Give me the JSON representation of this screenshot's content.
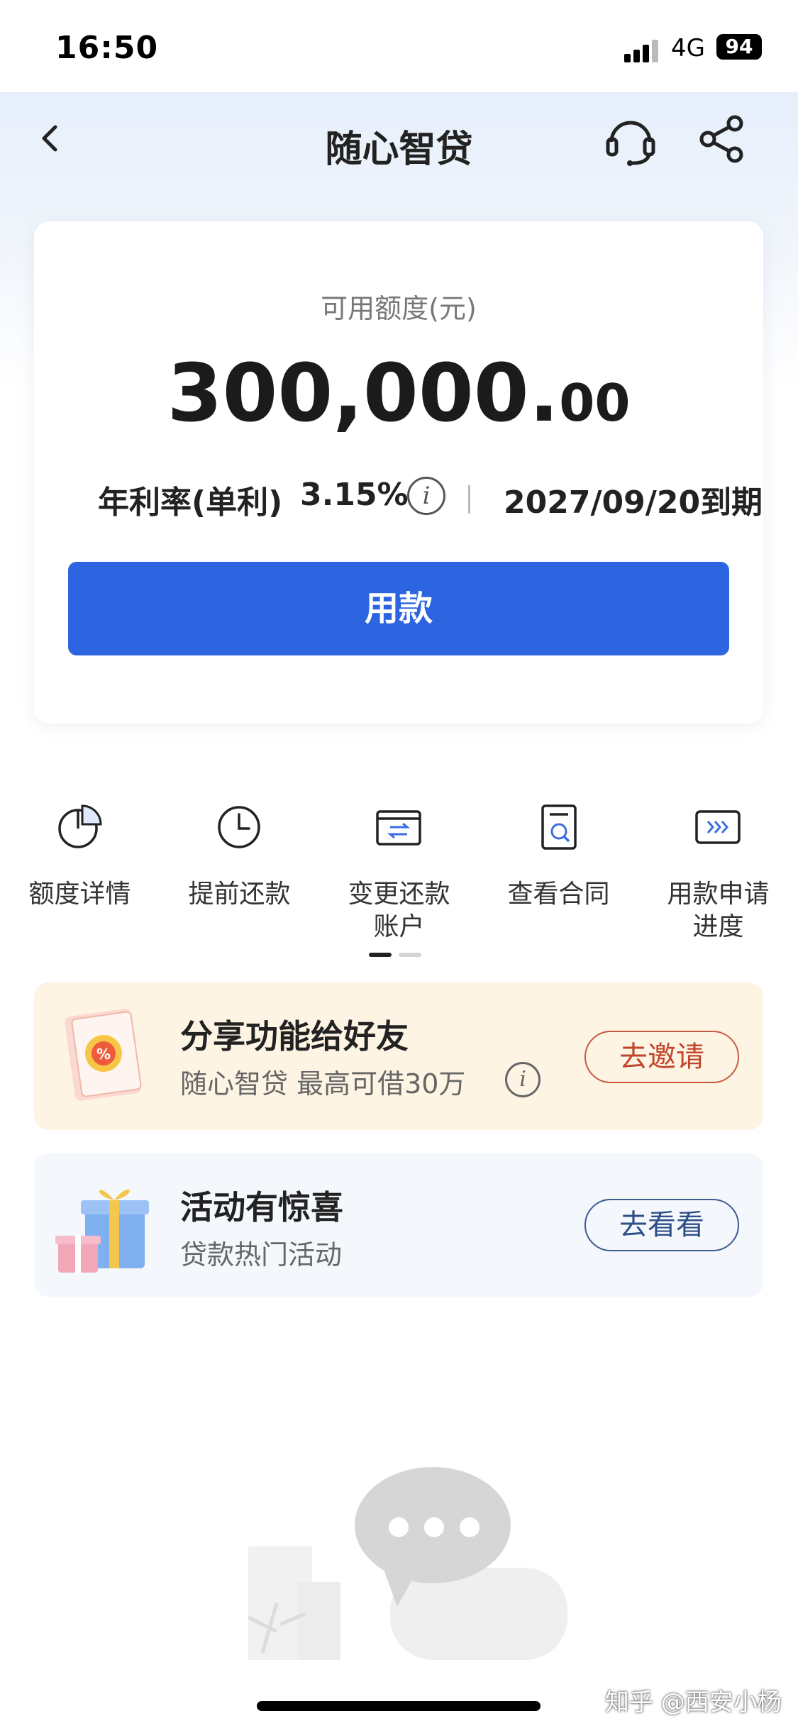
{
  "status_bar": {
    "time": "16:50",
    "network": "4G",
    "battery": "94"
  },
  "nav": {
    "title": "随心智贷",
    "back_icon": "chevron-left-icon",
    "service_icon": "headset-icon",
    "share_icon": "share-icon"
  },
  "credit": {
    "label": "可用额度(元)",
    "amount_int": "300,000.",
    "amount_dec": "00",
    "rate_label": "年利率(单利)",
    "rate_value": "3.15%",
    "info_glyph": "i",
    "due_date": "2027/09/20到期",
    "use_button": "用款"
  },
  "quick_actions": [
    {
      "label": "额度详情",
      "icon": "pie-chart-icon"
    },
    {
      "label": "提前还款",
      "icon": "clock-icon"
    },
    {
      "label_line1": "变更还款",
      "label_line2": "账户",
      "icon": "card-exchange-icon"
    },
    {
      "label": "查看合同",
      "icon": "contract-search-icon"
    },
    {
      "label_line1": "用款申请",
      "label_line2": "进度",
      "icon": "progress-arrows-icon"
    }
  ],
  "pager": {
    "pages": 2,
    "active": 1
  },
  "promo": {
    "share": {
      "title": "分享功能给好友",
      "subtitle": "随心智贷 最高可借30万",
      "info_glyph": "i",
      "button": "去邀请",
      "accent": "#c0452b"
    },
    "activity": {
      "title": "活动有惊喜",
      "subtitle": "贷款热门活动",
      "button": "去看看",
      "accent": "#2d4e86"
    }
  },
  "colors": {
    "primary": "#2d64e0",
    "share_bg": "#fdf4e3",
    "activity_bg": "#f4f8fd"
  },
  "watermark": "知乎 @西安小杨"
}
